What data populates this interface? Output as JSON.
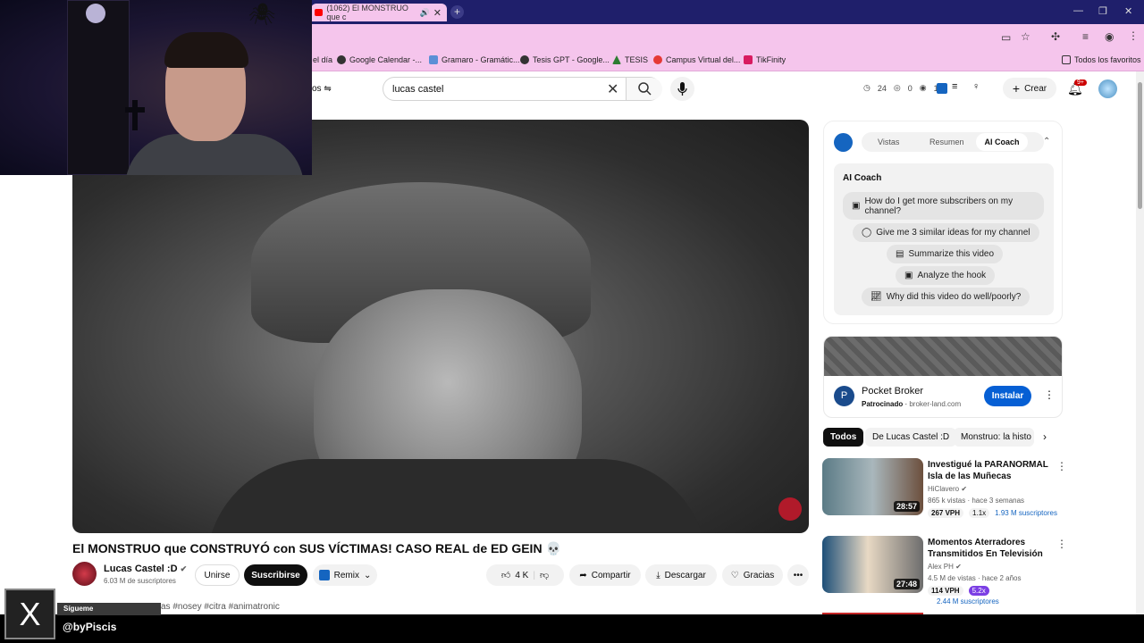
{
  "browser": {
    "tab_title": "(1062) El MONSTRUO que c",
    "new_tab": "+",
    "window_controls": [
      "—",
      "❐",
      "✕"
    ],
    "bookmarks": [
      {
        "label": "el día",
        "color": "#ffffff"
      },
      {
        "label": "Google Calendar -...",
        "color": "#333333"
      },
      {
        "label": "Gramaro - Gramátic...",
        "color": "#5b8fd6"
      },
      {
        "label": "Tesis GPT - Google...",
        "color": "#333333"
      },
      {
        "label": "TESIS",
        "color": "#2e7d32"
      },
      {
        "label": "Campus Virtual del...",
        "color": "#e53935"
      },
      {
        "label": "TikFinity",
        "color": "#d81b60"
      }
    ],
    "all_bookmarks": "Todos los favoritos"
  },
  "header": {
    "search_value": "lucas castel",
    "filters_label": "os",
    "stats": {
      "views": "24",
      "eye": "0",
      "watch": "1"
    },
    "create_label": "Crear",
    "notifications_badge": "9+"
  },
  "video": {
    "title": "El MONSTRUO que CONSTRUYÓ con SUS VÍCTIMAS! CASO REAL de ED GEIN 💀",
    "channel": "Lucas Castel :D",
    "subscribers": "6.03 M de suscriptores",
    "join": "Unirse",
    "subscribe": "Suscribirse",
    "remix": "Remix",
    "likes": "4 K",
    "share": "Compartir",
    "download": "Descargar",
    "thanks": "Gracias",
    "tags_prefix": "as",
    "tags": "#nosey #citra #animatronic"
  },
  "coach": {
    "tabs": [
      "Vistas",
      "Resumen",
      "AI Coach"
    ],
    "heading": "AI Coach",
    "questions": [
      "How do I get more subscribers on my channel?",
      "Give me 3 similar ideas for my channel",
      "Summarize this video",
      "Analyze the hook",
      "Why did this video do well/poorly?"
    ]
  },
  "ad": {
    "name": "Pocket Broker",
    "sponsored": "Patrocinado",
    "domain": "broker-land.com",
    "install": "Instalar",
    "logo_letter": "P"
  },
  "chips": [
    "Todos",
    "De Lucas Castel :D",
    "Monstruo: la histo"
  ],
  "recommendations": [
    {
      "title": "Investigué la PARANORMAL Isla de las Muñecas",
      "channel": "HiClavero",
      "meta": "865 k vistas · hace 3 semanas",
      "duration": "28:57",
      "vph": "267 VPH",
      "mult": "1.1x",
      "subs": "1.93 M suscriptores"
    },
    {
      "title": "Momentos Aterradores Transmitidos En Televisión",
      "channel": "Alex PH",
      "meta": "4.5 M de vistas · hace 2 años",
      "duration": "27:48",
      "vph": "114 VPH",
      "mult": "5.2x",
      "subs": "2.44 M suscriptores"
    }
  ],
  "overlay": {
    "sigueme": "Sígueme",
    "handle": "@byPiscis",
    "x_logo": "X"
  }
}
